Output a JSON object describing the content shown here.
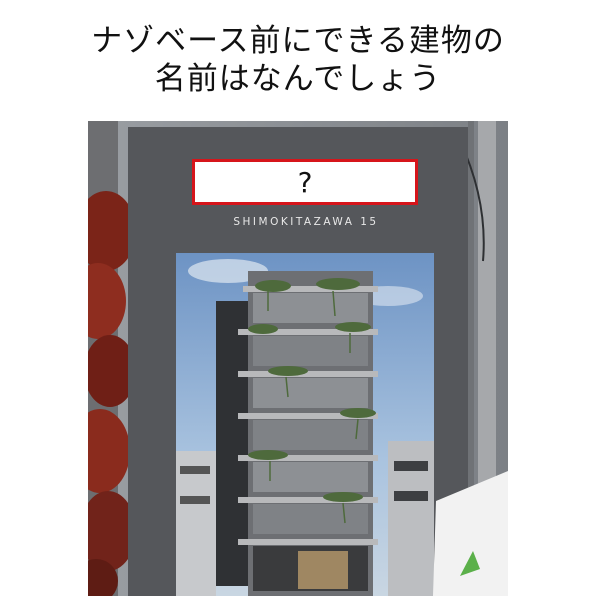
{
  "title": {
    "line1": "ナゾベース前にできる建物の",
    "line2": "名前はなんでしょう"
  },
  "banner": {
    "answer_placeholder": "?",
    "brand_text": "SHIMOKITAZAWA 15"
  },
  "colors": {
    "highlight_border": "#d6151b",
    "banner_bg": "#55575b",
    "sky": "#8fb0d4"
  }
}
